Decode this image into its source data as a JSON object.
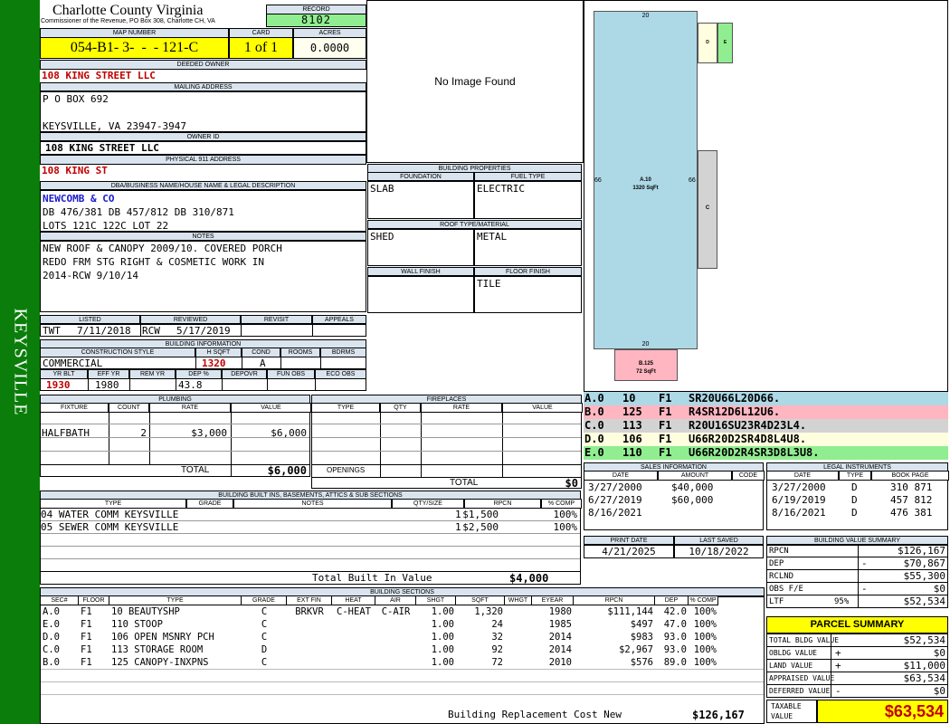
{
  "sidebar": {
    "label": "KEYSVILLE",
    "color": "#0a7d0a"
  },
  "header": {
    "county": "Charlotte County Virginia",
    "commissioner": "Commissioner of the Revenue, PO Box 308, Charlotte CH, VA",
    "record_label": "RECORD",
    "record": "8102",
    "map_number_label": "MAP NUMBER",
    "map_number": "054-B1- 3-  -  - 121-C",
    "card_label": "CARD",
    "card": "1 of 1",
    "acres_label": "ACRES",
    "acres": "0.0000"
  },
  "owner": {
    "deeded_label": "DEEDED OWNER",
    "deeded": "108 KING STREET LLC",
    "mailing_label": "MAILING ADDRESS",
    "mailing1": "P O BOX 692",
    "mailing2": "",
    "mailing3": "KEYSVILLE, VA 23947-3947",
    "owner_id_label": "OWNER ID",
    "owner_id": "108 KING STREET LLC",
    "physical_label": "PHYSICAL 911 ADDRESS",
    "physical": "108 KING ST",
    "dba_label": "DBA/BUSINESS NAME/HOUSE NAME & LEGAL DESCRIPTION",
    "dba1": "NEWCOMB & CO",
    "dba2": "DB 476/381 DB 457/812 DB 310/871",
    "dba3": "LOTS 121C 122C LOT 22",
    "notes_label": "NOTES",
    "notes1": "NEW ROOF & CANOPY 2009/10. COVERED PORCH",
    "notes2": "REDO FRM STG RIGHT & COSMETIC WORK IN",
    "notes3": "2014-RCW 9/10/14"
  },
  "review": {
    "listed_label": "LISTED",
    "listed_by": "TWT",
    "listed_date": "7/11/2018",
    "reviewed_label": "REVIEWED",
    "reviewed_by": "RCW",
    "reviewed_date": "5/17/2019",
    "revisit_label": "REVISIT",
    "appeals_label": "APPEALS"
  },
  "building_info": {
    "label": "BUILDING INFORMATION",
    "style_label": "CONSTRUCTION STYLE",
    "style": "COMMERCIAL",
    "hsqft_label": "H SQFT",
    "hsqft": "1320",
    "cond_label": "COND",
    "cond": "A",
    "rooms_label": "ROOMS",
    "bdrms_label": "BDRMS",
    "yrblt_label": "YR BLT",
    "yrblt": "1930",
    "effyr_label": "EFF YR",
    "effyr": "1980",
    "remyr_label": "REM YR",
    "dep_label": "DEP %",
    "dep": "43.8",
    "depovr_label": "DEPOVR",
    "funobs_label": "FUN OBS",
    "ecoobs_label": "ECO OBS"
  },
  "image": {
    "no_image": "No Image Found"
  },
  "building_props": {
    "label": "BUILDING PROPERTIES",
    "foundation_label": "FOUNDATION",
    "foundation": "SLAB",
    "fuel_label": "FUEL TYPE",
    "fuel": "ELECTRIC",
    "roof_label": "ROOF TYPE/MATERIAL",
    "roof_type": "SHED",
    "roof_material": "METAL",
    "wall_label": "WALL FINISH",
    "wall": "",
    "floor_label": "FLOOR FINISH",
    "floor": "TILE"
  },
  "sketch": {
    "a_label": "A.10",
    "a_area": "1320 SqFt",
    "top": "20",
    "bottom": "20",
    "left": "66",
    "right": "66",
    "b_label": "B.125",
    "b_area": "72 SqFt",
    "c_label": "C",
    "d_label": "D",
    "e_label": "E",
    "colors": {
      "a": "#add8e6",
      "b": "#ffb6c1",
      "c": "#d3d3d3",
      "d": "#ffffe0",
      "e": "#90ee90"
    }
  },
  "sketch_codes": [
    {
      "sec": "A.0",
      "code": "10",
      "floor": "F1",
      "vec": "SR20U66L20D66.",
      "color": "#add8e6"
    },
    {
      "sec": "B.0",
      "code": "125",
      "floor": "F1",
      "vec": "R4SR12D6L12U6.",
      "color": "#ffb6c1"
    },
    {
      "sec": "C.0",
      "code": "113",
      "floor": "F1",
      "vec": "R20U16SU23R4D23L4.",
      "color": "#d3d3d3"
    },
    {
      "sec": "D.0",
      "code": "106",
      "floor": "F1",
      "vec": "U66R20D2SR4D8L4U8.",
      "color": "#ffffe0"
    },
    {
      "sec": "E.0",
      "code": "110",
      "floor": "F1",
      "vec": "U66R20D2R4SR3D8L3U8.",
      "color": "#90ee90"
    }
  ],
  "plumbing": {
    "label": "PLUMBING",
    "fixture_label": "FIXTURE",
    "count_label": "COUNT",
    "rate_label": "RATE",
    "value_label": "VALUE",
    "rows": [
      {
        "fixture": "HALFBATH",
        "count": "2",
        "rate": "$3,000",
        "value": "$6,000"
      }
    ],
    "total_label": "TOTAL",
    "total": "$6,000"
  },
  "fireplaces": {
    "label": "FIREPLACES",
    "type_label": "TYPE",
    "qty_label": "QTY",
    "rate_label": "RATE",
    "value_label": "VALUE",
    "openings_label": "OPENINGS",
    "total_label": "TOTAL",
    "total": "$0"
  },
  "sales": {
    "label": "SALES INFORMATION",
    "date_label": "DATE",
    "amount_label": "AMOUNT",
    "code_label": "CODE",
    "rows": [
      {
        "date": "3/27/2000",
        "amount": "$40,000",
        "code": ""
      },
      {
        "date": "6/27/2019",
        "amount": "$60,000",
        "code": ""
      },
      {
        "date": "8/16/2021",
        "amount": "",
        "code": ""
      }
    ]
  },
  "legal": {
    "label": "LEGAL INSTRUMENTS",
    "date_label": "DATE",
    "type_label": "TYPE",
    "book_label": "BOOK PAGE",
    "rows": [
      {
        "date": "3/27/2000",
        "type": "D",
        "book": "310 871"
      },
      {
        "date": "6/19/2019",
        "type": "D",
        "book": "457 812"
      },
      {
        "date": "8/16/2021",
        "type": "D",
        "book": "476 381"
      }
    ]
  },
  "builtins": {
    "label": "BUILDING BUILT INS, BASEMENTS, ATTICS & SUB SECTIONS",
    "type_label": "TYPE",
    "grade_label": "GRADE",
    "notes_label": "NOTES",
    "qty_label": "QTY/SIZE",
    "rpcn_label": "RPCN",
    "comp_label": "% COMP",
    "rows": [
      {
        "type": "04 WATER COMM KEYSVILLE",
        "qty": "1",
        "rpcn": "$1,500",
        "comp": "100%"
      },
      {
        "type": "05 SEWER COMM KEYSVILLE",
        "qty": "1",
        "rpcn": "$2,500",
        "comp": "100%"
      }
    ],
    "total_label": "Total Built In Value",
    "total": "$4,000"
  },
  "dates": {
    "print_label": "PRINT DATE",
    "print": "4/21/2025",
    "saved_label": "LAST SAVED",
    "saved": "10/18/2022"
  },
  "value_summary": {
    "label": "BUILDING VALUE SUMMARY",
    "rows": [
      {
        "k": "RPCN",
        "sign": "",
        "v": "$126,167"
      },
      {
        "k": "DEP",
        "sign": "-",
        "v": "$70,867"
      },
      {
        "k": "RCLND",
        "sign": "",
        "v": "$55,300"
      },
      {
        "k": "OBS F/E",
        "sign": "-",
        "v": "$0"
      },
      {
        "k": "LTF",
        "pct": "95%",
        "sign": "",
        "v": "$52,534"
      }
    ]
  },
  "parcel": {
    "label": "PARCEL SUMMARY",
    "rows": [
      {
        "k": "TOTAL BLDG VALUE",
        "sign": "",
        "v": "$52,534"
      },
      {
        "k": "OBLDG VALUE",
        "sign": "+",
        "v": "$0"
      },
      {
        "k": "LAND VALUE",
        "sign": "+",
        "v": "$11,000"
      },
      {
        "k": "APPRAISED VALUE",
        "sign": "",
        "v": "$63,534"
      },
      {
        "k": "DEFERRED VALUE",
        "sign": "-",
        "v": "$0"
      }
    ],
    "taxable_label": "TAXABLE VALUE",
    "taxable": "$63,534"
  },
  "sections": {
    "label": "BUILDING SECTIONS",
    "headers": [
      "SEC#",
      "FLOOR",
      "TYPE",
      "GRADE",
      "EXT FIN",
      "HEAT",
      "AIR",
      "SHGT",
      "SQFT",
      "WHGT",
      "EYEAR",
      "RPCN",
      "DEP",
      "% COMP"
    ],
    "rows": [
      {
        "sec": "A.0",
        "floor": "F1",
        "type": "10 BEAUTYSHP",
        "grade": "C",
        "ext": "BRKVR",
        "heat": "C-HEAT",
        "air": "C-AIR",
        "shgt": "1.00",
        "sqft": "1,320",
        "whgt": "",
        "eyear": "1980",
        "rpcn": "$111,144",
        "dep": "42.0",
        "comp": "100%"
      },
      {
        "sec": "E.0",
        "floor": "F1",
        "type": "110 STOOP",
        "grade": "C",
        "ext": "",
        "heat": "",
        "air": "",
        "shgt": "1.00",
        "sqft": "24",
        "whgt": "",
        "eyear": "1985",
        "rpcn": "$497",
        "dep": "47.0",
        "comp": "100%"
      },
      {
        "sec": "D.0",
        "floor": "F1",
        "type": "106 OPEN MSNRY PCH",
        "grade": "C",
        "ext": "",
        "heat": "",
        "air": "",
        "shgt": "1.00",
        "sqft": "32",
        "whgt": "",
        "eyear": "2014",
        "rpcn": "$983",
        "dep": "93.0",
        "comp": "100%"
      },
      {
        "sec": "C.0",
        "floor": "F1",
        "type": "113 STORAGE ROOM",
        "grade": "D",
        "ext": "",
        "heat": "",
        "air": "",
        "shgt": "1.00",
        "sqft": "92",
        "whgt": "",
        "eyear": "2014",
        "rpcn": "$2,967",
        "dep": "93.0",
        "comp": "100%"
      },
      {
        "sec": "B.0",
        "floor": "F1",
        "type": "125 CANOPY-INXPNS",
        "grade": "C",
        "ext": "",
        "heat": "",
        "air": "",
        "shgt": "1.00",
        "sqft": "72",
        "whgt": "",
        "eyear": "2010",
        "rpcn": "$576",
        "dep": "89.0",
        "comp": "100%"
      }
    ],
    "total_label": "Building Replacement Cost New",
    "total": "$126,167"
  }
}
